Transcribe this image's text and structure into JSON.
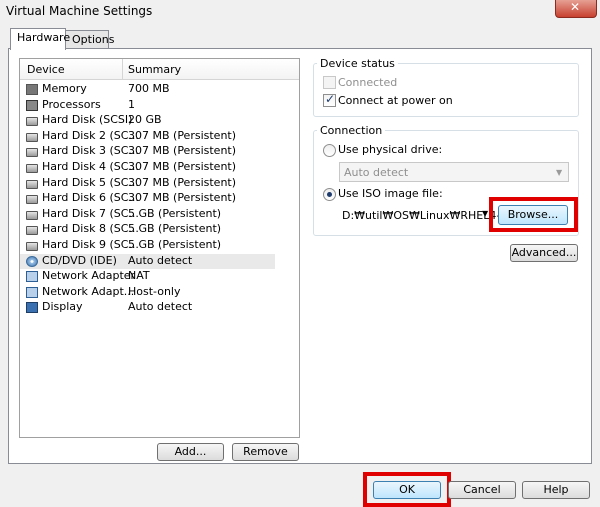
{
  "window": {
    "title": "Virtual Machine Settings"
  },
  "tabs": [
    {
      "label": "Hardware"
    },
    {
      "label": "Options"
    }
  ],
  "device_list": {
    "columns": {
      "device": "Device",
      "summary": "Summary"
    },
    "rows": [
      {
        "icon": "memory-icon",
        "device": "Memory",
        "summary": "700 MB"
      },
      {
        "icon": "processor-icon",
        "device": "Processors",
        "summary": "1"
      },
      {
        "icon": "hard-disk-icon",
        "device": "Hard Disk (SCSI)",
        "summary": "20 GB"
      },
      {
        "icon": "hard-disk-icon",
        "device": "Hard Disk 2 (SC...",
        "summary": "307 MB (Persistent)"
      },
      {
        "icon": "hard-disk-icon",
        "device": "Hard Disk 3 (SC...",
        "summary": "307 MB (Persistent)"
      },
      {
        "icon": "hard-disk-icon",
        "device": "Hard Disk 4 (SC...",
        "summary": "307 MB (Persistent)"
      },
      {
        "icon": "hard-disk-icon",
        "device": "Hard Disk 5 (SC...",
        "summary": "307 MB (Persistent)"
      },
      {
        "icon": "hard-disk-icon",
        "device": "Hard Disk 6 (SC...",
        "summary": "307 MB (Persistent)"
      },
      {
        "icon": "hard-disk-icon",
        "device": "Hard Disk 7 (SC...",
        "summary": "5 GB (Persistent)"
      },
      {
        "icon": "hard-disk-icon",
        "device": "Hard Disk 8 (SC...",
        "summary": "5 GB (Persistent)"
      },
      {
        "icon": "hard-disk-icon",
        "device": "Hard Disk 9 (SC...",
        "summary": "5 GB (Persistent)"
      },
      {
        "icon": "cd-dvd-icon",
        "device": "CD/DVD (IDE)",
        "summary": "Auto detect",
        "selected": true
      },
      {
        "icon": "network-adapter-icon",
        "device": "Network Adapter",
        "summary": "NAT"
      },
      {
        "icon": "network-adapter-icon",
        "device": "Network Adapt...",
        "summary": "Host-only"
      },
      {
        "icon": "display-icon",
        "device": "Display",
        "summary": "Auto detect"
      }
    ],
    "add_label": "Add...",
    "remove_label": "Remove"
  },
  "device_status": {
    "title": "Device status",
    "connected_label": "Connected",
    "connected_checked": false,
    "connect_at_power_on_label": "Connect at power on",
    "connect_at_power_on_checked": true
  },
  "connection": {
    "title": "Connection",
    "physical_drive_label": "Use physical drive:",
    "physical_drive_value": "Auto detect",
    "iso_label": "Use ISO image file:",
    "iso_selected": true,
    "iso_path": "D:₩util₩OS₩Linux₩RHEL4-",
    "browse_label": "Browse..."
  },
  "advanced_label": "Advanced...",
  "footer": {
    "ok_label": "OK",
    "cancel_label": "Cancel",
    "help_label": "Help"
  },
  "highlight_color": "#e00000"
}
